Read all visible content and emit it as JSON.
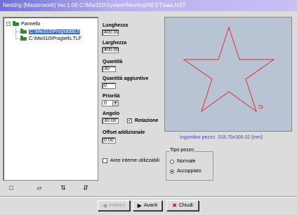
{
  "window": {
    "title": "Nesting [Masterwork] Ver.1.00   C:\\Mw310\\System\\Nesting\\NEST\\aaa.NST"
  },
  "tree": {
    "root_label": "Pannello",
    "root_expander": "-",
    "items": [
      {
        "label": "C:\\Mw310\\Prog\\dddd.tl",
        "selected": true
      },
      {
        "label": "C:\\Mw310\\Prog\\ells.TLF",
        "selected": false
      }
    ]
  },
  "toolbar": {
    "icons": [
      "new-icon",
      "open-folder-icon",
      "sort-icon",
      "sort-reverse-icon"
    ],
    "glyphs": [
      "□",
      "▱",
      "⇅",
      "⇵"
    ]
  },
  "form": {
    "lunghezza_label": "Lunghezza",
    "lunghezza_value": "400.00",
    "larghezza_label": "Larghezza",
    "larghezza_value": "400.00",
    "quantita_label": "Quantità",
    "quantita_value": "30",
    "quantita_aggiuntive_label": "Quantità aggiuntive",
    "quantita_aggiuntive_value": "0",
    "priorita_label": "Priorità",
    "priorita_value": "0",
    "angolo_label": "Angolo",
    "angolo_value": "30.00",
    "rotazione_label": "Rotazione",
    "rotazione_checked": true,
    "rotazione_mark": "✓",
    "offset_label": "Offset addizionale",
    "offset_value": "0.00",
    "aree_label": "Aree interne utilizzabili",
    "aree_checked": false
  },
  "preview": {
    "ingombro_label": "Ingombro pezzo",
    "ingombro_value": "318.70x306.02 [mm]",
    "background_color": "#b8c4d4",
    "shape_color": "#e03030"
  },
  "tipo_pezzo": {
    "title": "Tipo pezzo",
    "options": [
      {
        "label": "Normale",
        "selected": false
      },
      {
        "label": "Accoppiato",
        "selected": true
      }
    ]
  },
  "buttons": {
    "indietro_label": "Indietro",
    "indietro_enabled": false,
    "avanti_label": "Avanti",
    "chiudi_label": "Chiudi",
    "indietro_glyph": "◀",
    "avanti_glyph": "▶",
    "chiudi_glyph": "✖"
  }
}
